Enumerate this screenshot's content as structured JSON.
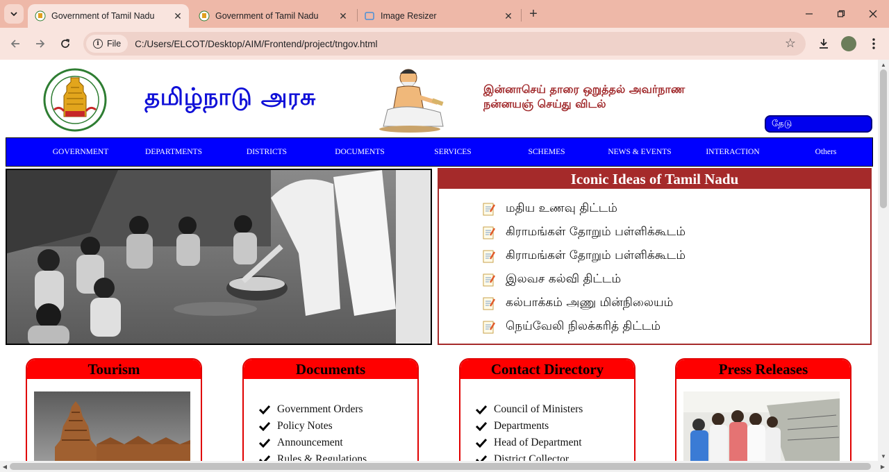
{
  "browser": {
    "tabs": [
      {
        "title": "Government of Tamil Nadu",
        "active": true
      },
      {
        "title": "Government of Tamil Nadu",
        "active": false
      },
      {
        "title": "Image Resizer",
        "active": false
      }
    ],
    "site_chip": "File",
    "url": "C:/Users/ELCOT/Desktop/AIM/Frontend/project/tngov.html",
    "icons": [
      "tab-search-icon",
      "back-arrow-icon",
      "forward-arrow-icon",
      "reload-icon",
      "info-icon",
      "star-icon",
      "download-icon",
      "profile-avatar",
      "kebab-menu-icon",
      "minimize-icon",
      "restore-icon",
      "close-icon"
    ]
  },
  "header": {
    "title": "தமிழ்நாடு அரசு",
    "kural_line1": "இன்னாசெய் தாரை ஒறுத்தல் அவர்நாண",
    "kural_line2": "நன்னயஞ் செய்து விடல்",
    "search_placeholder": "தேடு"
  },
  "nav": {
    "items": [
      "GOVERNMENT",
      "DEPARTMENTS",
      "DISTRICTS",
      "DOCUMENTS",
      "SERVICES",
      "SCHEMES",
      "NEWS & EVENTS",
      "INTERACTION",
      "Others"
    ]
  },
  "ideas": {
    "title": "Iconic Ideas of Tamil Nadu",
    "items": [
      "மதிய உணவு திட்டம்",
      "கிராமங்கள் தோறும் பள்ளிக்கூடம்",
      "கிராமங்கள் தோறும் பள்ளிக்கூடம்",
      "இலவச கல்வி திட்டம்",
      "கல்பாக்கம் அணு மின்நிலையம்",
      "நெய்வேலி நிலக்கரித் திட்டம்"
    ]
  },
  "cards": {
    "tourism": {
      "title": "Tourism"
    },
    "documents": {
      "title": "Documents",
      "items": [
        "Government Orders",
        "Policy Notes",
        "Announcement",
        "Rules & Regulations"
      ]
    },
    "contact": {
      "title": "Contact Directory",
      "items": [
        "Council of Ministers",
        "Departments",
        "Head of Department",
        "District Collector"
      ]
    },
    "press": {
      "title": "Press Releases"
    }
  },
  "colors": {
    "tab_bar": "#eeb8a8",
    "nav_blue": "#0000ff",
    "title_blue": "#1010d8",
    "ideas_brown": "#a52a2a",
    "card_red": "#ff0000",
    "kural_red": "#a0282a"
  }
}
